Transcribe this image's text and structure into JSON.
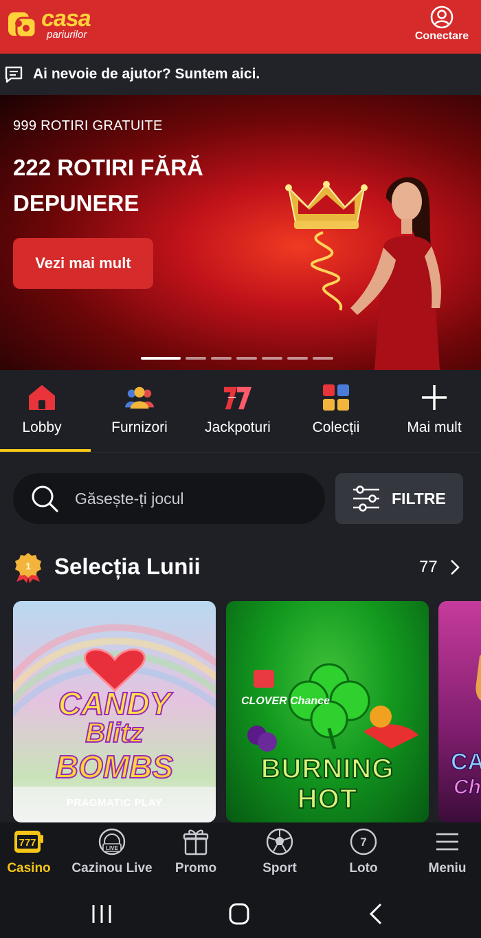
{
  "header": {
    "logo_brand": "casa",
    "logo_sub": "pariurilor",
    "connect_label": "Conectare",
    "accent": "#d62b2b",
    "logo_color": "#ffd23a"
  },
  "help": {
    "text": "Ai nevoie de ajutor? Suntem aici.",
    "icon": "chat-icon"
  },
  "banner": {
    "subtitle": "999 ROTIRI GRATUITE",
    "title": "222 ROTIRI FĂRĂ DEPUNERE",
    "button_label": "Vezi mai mult",
    "slide_count": 8,
    "active_slide": 1
  },
  "categories": [
    {
      "label": "Lobby",
      "icon": "house-icon",
      "active": true
    },
    {
      "label": "Furnizori",
      "icon": "people-icon",
      "active": false
    },
    {
      "label": "Jackpoturi",
      "icon": "sevens-icon",
      "active": false
    },
    {
      "label": "Colecții",
      "icon": "grid-icon",
      "active": false
    },
    {
      "label": "Mai mult",
      "icon": "plus-icon",
      "active": false
    }
  ],
  "search": {
    "placeholder": "Găsește-ți jocul",
    "filters_label": "FILTRE"
  },
  "section": {
    "title": "Selecția Lunii",
    "count": "77",
    "badge": "1"
  },
  "games": [
    {
      "title_lines": [
        "CANDY",
        "Blitz",
        "BOMBS"
      ],
      "provider": "PRAGMATIC PLAY"
    },
    {
      "title_lines": [
        "BURNING",
        "HOT"
      ],
      "tag": "CLOVER Chance"
    },
    {
      "title_lines": [
        "CAS",
        "Ch"
      ]
    }
  ],
  "bottom_nav": [
    {
      "label": "Casino",
      "icon": "casino-777-icon",
      "active": true
    },
    {
      "label": "Cazinou Live",
      "icon": "live-roulette-icon",
      "active": false
    },
    {
      "label": "Promo",
      "icon": "gift-icon",
      "active": false
    },
    {
      "label": "Sport",
      "icon": "soccer-ball-icon",
      "active": false
    },
    {
      "label": "Loto",
      "icon": "lotto-ball-icon",
      "badge": "7",
      "active": false
    },
    {
      "label": "Meniu",
      "icon": "hamburger-menu-icon",
      "active": false
    }
  ],
  "system_nav": [
    "recent-apps-icon",
    "home-icon",
    "back-icon"
  ],
  "colors": {
    "active_yellow": "#f5c518",
    "background": "#1e2025",
    "nav_background": "#15171b"
  }
}
